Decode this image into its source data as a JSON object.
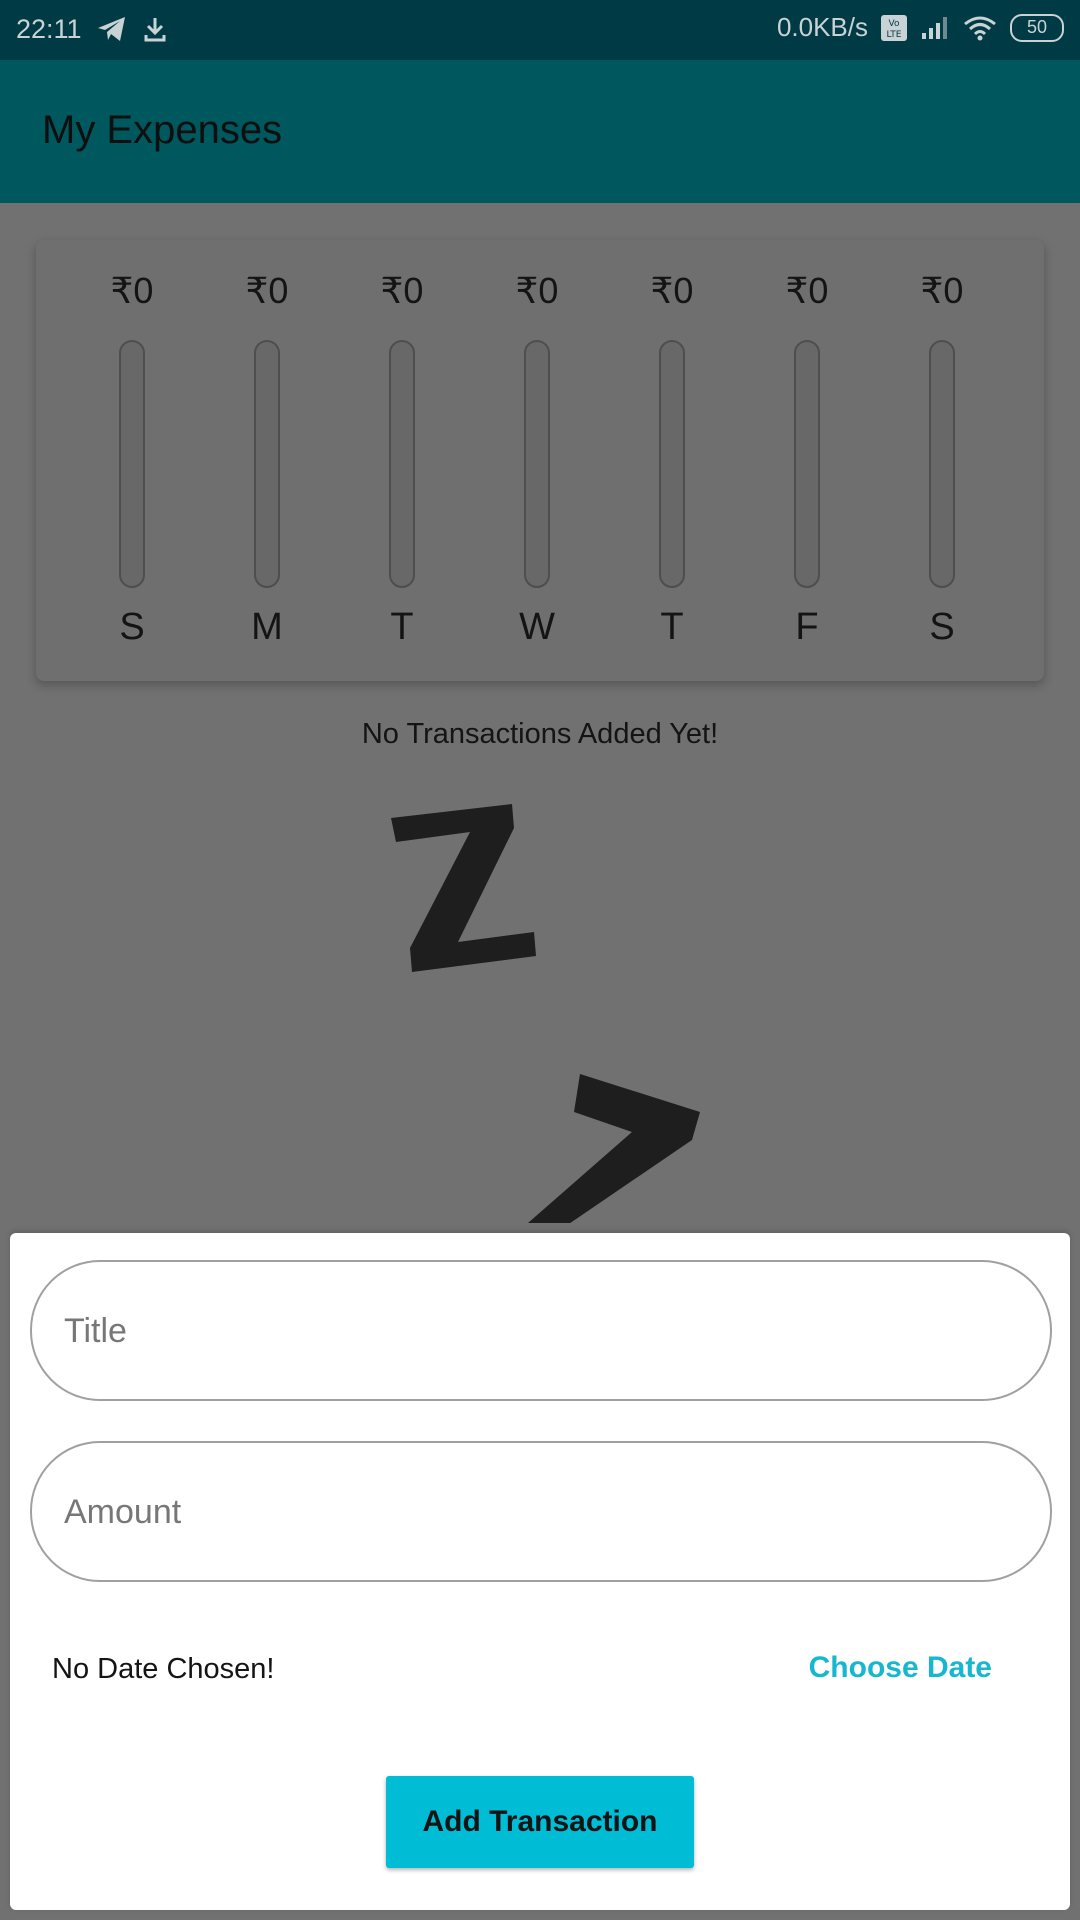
{
  "status_bar": {
    "time": "22:11",
    "network_speed": "0.0KB/s",
    "battery_level": "50",
    "icons": [
      "telegram-icon",
      "download-icon",
      "volte-icon",
      "signal-icon",
      "wifi-icon",
      "battery-icon"
    ]
  },
  "app_bar": {
    "title": "My Expenses"
  },
  "chart": {
    "bars": [
      {
        "day": "S",
        "amount": "₹0",
        "fill": 0
      },
      {
        "day": "M",
        "amount": "₹0",
        "fill": 0
      },
      {
        "day": "T",
        "amount": "₹0",
        "fill": 0
      },
      {
        "day": "W",
        "amount": "₹0",
        "fill": 0
      },
      {
        "day": "T",
        "amount": "₹0",
        "fill": 0
      },
      {
        "day": "F",
        "amount": "₹0",
        "fill": 0
      },
      {
        "day": "S",
        "amount": "₹0",
        "fill": 0
      }
    ]
  },
  "transactions": {
    "empty_message": "No Transactions Added Yet!",
    "empty_image": "sleeping-zzz-image"
  },
  "new_transaction_form": {
    "title_placeholder": "Title",
    "amount_placeholder": "Amount",
    "date_label": "No Date Chosen!",
    "choose_date_label": "Choose Date",
    "submit_label": "Add Transaction"
  },
  "colors": {
    "status_bar_bg": "#003a44",
    "app_bar_bg": "#00585f",
    "accent": "#00bcd4",
    "accent_text": "#17b7cf",
    "scrim_bg": "#717171"
  }
}
